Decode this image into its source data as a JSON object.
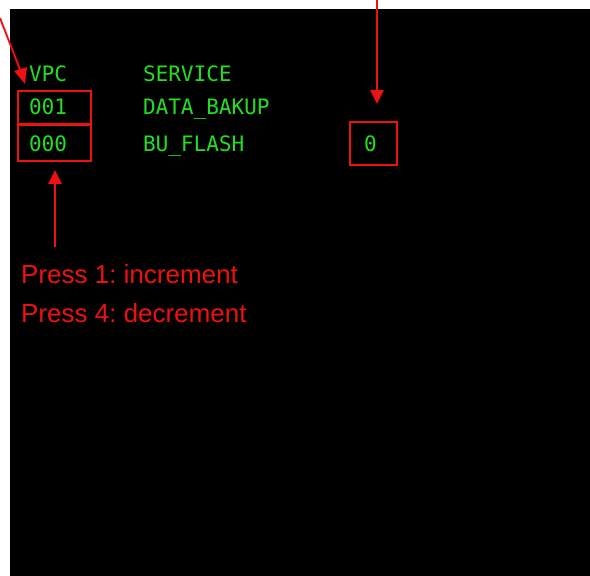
{
  "screen": {
    "headers": {
      "vpc": "VPC",
      "service": "SERVICE"
    },
    "rows": [
      {
        "vpc": "001",
        "service": "DATA_BAKUP",
        "value": ""
      },
      {
        "vpc": "000",
        "service": "BU_FLASH",
        "value": "0"
      }
    ]
  },
  "annotations": {
    "line1": "Press 1: increment",
    "line2": "Press 4: decrement"
  },
  "colors": {
    "terminal_bg": "#000000",
    "terminal_text": "#22dd22",
    "annotation": "#ee1111"
  }
}
